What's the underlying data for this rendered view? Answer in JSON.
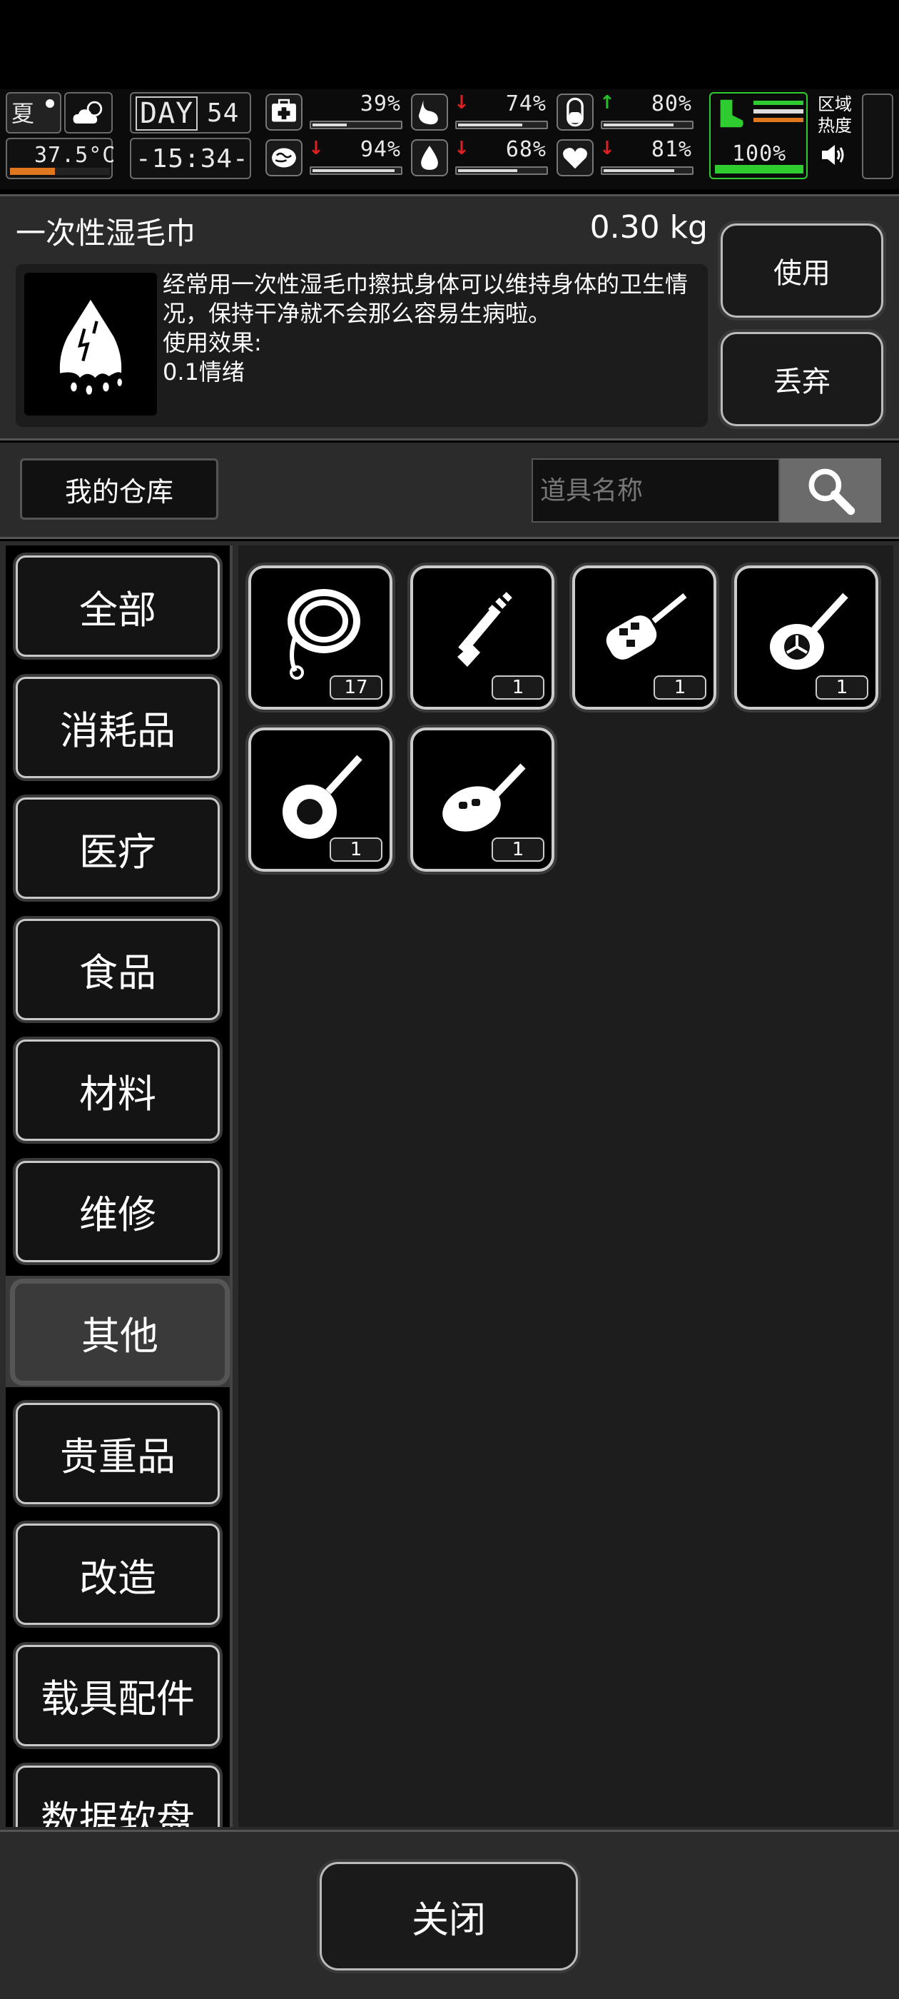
{
  "hud": {
    "season": "夏",
    "temperature": "37.5°C",
    "temperature_level": 0.45,
    "day_label": "DAY",
    "day_number": "54",
    "time": "-15:34-",
    "stats": [
      {
        "name": "health",
        "icon": "medkit-icon",
        "value": "39%",
        "level": 0.39,
        "trend": "none"
      },
      {
        "name": "hunger",
        "icon": "stomach-icon",
        "value": "74%",
        "level": 0.74,
        "trend": "down"
      },
      {
        "name": "stamina",
        "icon": "pill-icon",
        "value": "80%",
        "level": 0.8,
        "trend": "up"
      },
      {
        "name": "mental",
        "icon": "brain-icon",
        "value": "94%",
        "level": 0.94,
        "trend": "down"
      },
      {
        "name": "thirst",
        "icon": "water-drop-icon",
        "value": "68%",
        "level": 0.68,
        "trend": "down"
      },
      {
        "name": "mood",
        "icon": "heart-icon",
        "value": "81%",
        "level": 0.81,
        "trend": "down"
      }
    ],
    "energy": {
      "value": "100%",
      "level": 1.0
    },
    "zone_label": "区域\n热度",
    "colors": {
      "energy_green": "#2ecc2e",
      "temp_orange": "#e07820",
      "arrow_red": "#e02020",
      "arrow_green": "#28c028"
    }
  },
  "item": {
    "name": "一次性湿毛巾",
    "weight": "0.30 kg",
    "description": "经常用一次性湿毛巾擦拭身体可以维持身体的卫生情况，保持干净就不会那么容易生病啦。",
    "effect_label": "使用效果:",
    "effect_value": "0.1情绪",
    "icon": "wet-towel-icon",
    "use_label": "使用",
    "discard_label": "丢弃"
  },
  "warehouse": {
    "title": "我的仓库",
    "search_placeholder": "道具名称"
  },
  "categories": [
    {
      "label": "全部",
      "active": false
    },
    {
      "label": "消耗品",
      "active": false
    },
    {
      "label": "医疗",
      "active": false
    },
    {
      "label": "食品",
      "active": false
    },
    {
      "label": "材料",
      "active": false
    },
    {
      "label": "维修",
      "active": false
    },
    {
      "label": "其他",
      "active": true
    },
    {
      "label": "贵重品",
      "active": false
    },
    {
      "label": "改造",
      "active": false
    },
    {
      "label": "载具配件",
      "active": false
    },
    {
      "label": "数据软盘",
      "active": false
    }
  ],
  "items": [
    {
      "icon": "rope-icon",
      "count": "17"
    },
    {
      "icon": "key-icon",
      "count": "1"
    },
    {
      "icon": "car-flip-key-icon",
      "count": "1"
    },
    {
      "icon": "car-key-emblem-icon",
      "count": "1"
    },
    {
      "icon": "gear-key-icon",
      "count": "1"
    },
    {
      "icon": "car-key-fob-icon",
      "count": "1"
    }
  ],
  "footer": {
    "close_label": "关闭"
  }
}
